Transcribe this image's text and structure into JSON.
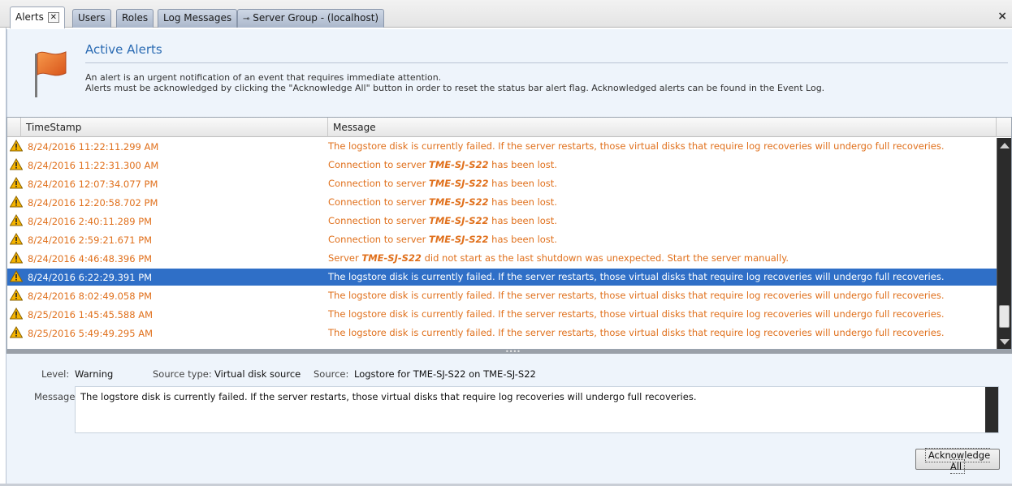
{
  "tabs": [
    {
      "label": "Alerts",
      "active": true,
      "closable": true
    },
    {
      "label": "Users"
    },
    {
      "label": "Roles"
    },
    {
      "label": "Log Messages"
    },
    {
      "label": "Server Group - (localhost)",
      "icon": "pin-icon"
    }
  ],
  "window_close": "×",
  "header": {
    "title": "Active Alerts",
    "line1": "An alert is an urgent notification of an event that requires immediate attention.",
    "line2": "Alerts must be acknowledged by clicking the \"Acknowledge All\" button in order to reset the status bar alert flag. Acknowledged alerts can be found in the Event Log.",
    "icon": "flag-icon",
    "accent": "#2b6bb3"
  },
  "grid": {
    "columns": [
      "TimeStamp",
      "Message"
    ],
    "warning_color": "#e0701c",
    "selected_color": "#2f6fc7",
    "rows": [
      {
        "ts": "8/24/2016 11:22:11.299 AM",
        "pre": "The logstore disk is currently failed. If the server restarts, those virtual disks that require log recoveries will undergo full recoveries.",
        "bold": "",
        "post": "",
        "selected": false
      },
      {
        "ts": "8/24/2016 11:22:31.300 AM",
        "pre": "Connection to server ",
        "bold": "TME-SJ-S22",
        "post": " has been lost.",
        "selected": false
      },
      {
        "ts": "8/24/2016 12:07:34.077 PM",
        "pre": "Connection to server ",
        "bold": "TME-SJ-S22",
        "post": " has been lost.",
        "selected": false
      },
      {
        "ts": "8/24/2016 12:20:58.702 PM",
        "pre": "Connection to server ",
        "bold": "TME-SJ-S22",
        "post": " has been lost.",
        "selected": false
      },
      {
        "ts": "8/24/2016 2:40:11.289 PM",
        "pre": "Connection to server ",
        "bold": "TME-SJ-S22",
        "post": " has been lost.",
        "selected": false
      },
      {
        "ts": "8/24/2016 2:59:21.671 PM",
        "pre": "Connection to server ",
        "bold": "TME-SJ-S22",
        "post": " has been lost.",
        "selected": false
      },
      {
        "ts": "8/24/2016 4:46:48.396 PM",
        "pre": "Server ",
        "bold": "TME-SJ-S22",
        "post": " did not start as the last shutdown was unexpected. Start the server manually.",
        "selected": false
      },
      {
        "ts": "8/24/2016 6:22:29.391 PM",
        "pre": "The logstore disk is currently failed. If the server restarts, those virtual disks that require log recoveries will undergo full recoveries.",
        "bold": "",
        "post": "",
        "selected": true
      },
      {
        "ts": "8/24/2016 8:02:49.058 PM",
        "pre": "The logstore disk is currently failed. If the server restarts, those virtual disks that require log recoveries will undergo full recoveries.",
        "bold": "",
        "post": "",
        "selected": false
      },
      {
        "ts": "8/25/2016 1:45:45.588 AM",
        "pre": "The logstore disk is currently failed. If the server restarts, those virtual disks that require log recoveries will undergo full recoveries.",
        "bold": "",
        "post": "",
        "selected": false
      },
      {
        "ts": "8/25/2016 5:49:49.295 AM",
        "pre": "The logstore disk is currently failed. If the server restarts, those virtual disks that require log recoveries will undergo full recoveries.",
        "bold": "",
        "post": "",
        "selected": false
      }
    ]
  },
  "detail": {
    "level_label": "Level:",
    "level_value": "Warning",
    "source_type_label": "Source type:",
    "source_type_value": "Virtual disk source",
    "source_label": "Source:",
    "source_value": "Logstore for TME-SJ-S22 on TME-SJ-S22",
    "message_label": "Message:",
    "message_value": "The logstore disk is currently failed. If the server restarts, those virtual disks that require log recoveries will undergo full recoveries."
  },
  "buttons": {
    "acknowledge_all": "Acknowledge All"
  }
}
